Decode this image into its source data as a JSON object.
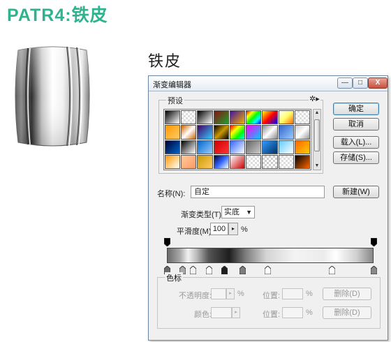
{
  "page": {
    "heading": "PATR4:铁皮",
    "sub_title": "铁皮"
  },
  "dialog": {
    "title": "渐变编辑器",
    "window_buttons": {
      "minimize": "—",
      "maximize": "□",
      "close": "X"
    },
    "presets_label": "预设",
    "buttons": {
      "ok": "确定",
      "cancel": "取消",
      "load": "载入(L)...",
      "save": "存储(S)...",
      "new": "新建(W)"
    },
    "name_label": "名称(N):",
    "name_value": "自定",
    "gradient_type_label": "渐变类型(T):",
    "gradient_type_value": "实底",
    "smoothness_label": "平滑度(M):",
    "smoothness_value": "100",
    "smoothness_unit": "%",
    "color_stops": {
      "group_label": "色标",
      "opacity_label": "不透明度:",
      "opacity_unit": "%",
      "location_label": "位置:",
      "location_unit": "%",
      "delete_label": "删除(D)",
      "color_label": "颜色:",
      "location2_label": "位置:",
      "location2_unit": "%",
      "delete2_label": "删除(D)"
    }
  },
  "colors": {
    "heading": "#2fb38f",
    "dialog_border": "#6c86a6"
  }
}
